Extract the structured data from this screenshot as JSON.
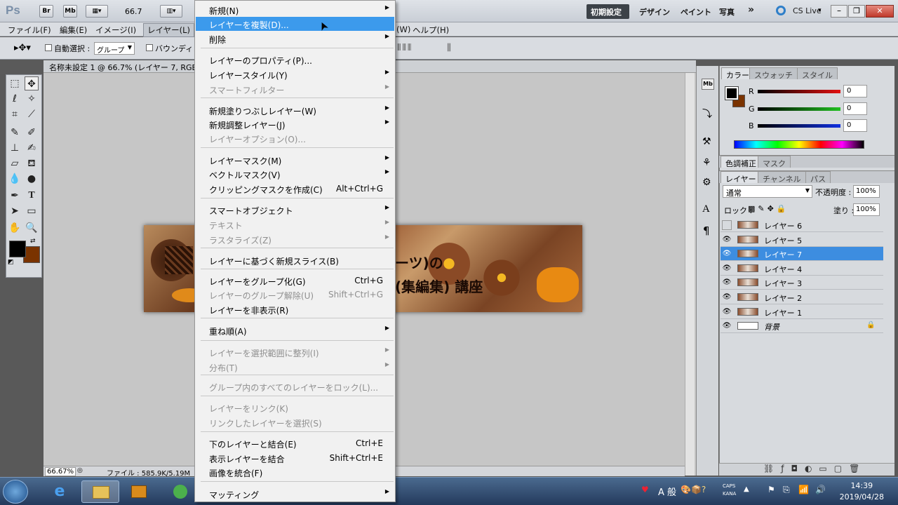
{
  "appbar": {
    "logo": "Ps",
    "br_label": "Br",
    "mb_label": "Mb",
    "zoom": "66.7",
    "workspaces": [
      "初期設定",
      "デザイン",
      "ペイント",
      "写真"
    ],
    "more": "»",
    "cs_live": "CS Live"
  },
  "menubar": [
    "ファイル(F)",
    "編集(E)",
    "イメージ(I)",
    "レイヤー(L)",
    "(W)",
    "ヘルプ(H)"
  ],
  "options": {
    "auto_select_label": "自動選択 :",
    "auto_select_value": "グループ",
    "bounding_label": "バウンディング"
  },
  "document": {
    "tab_title": "名称未設定 1 @ 66.7% (レイヤー 7, RGB/",
    "banner_text_1": "ーツ)の",
    "banner_text_2": "(集編集) 講座",
    "status_zoom": "66.67%",
    "status_file": "ファイル : 585.9K/5.19M"
  },
  "layer_menu": {
    "items": [
      {
        "label": "新規(N)",
        "shortcut": "",
        "arrow": true,
        "disabled": false
      },
      {
        "label": "レイヤーを複製(D)...",
        "shortcut": "",
        "arrow": false,
        "disabled": false,
        "highlighted": true
      },
      {
        "label": "削除",
        "shortcut": "",
        "arrow": true,
        "disabled": false
      },
      {
        "label": "レイヤーのプロパティ(P)...",
        "shortcut": "",
        "arrow": false,
        "disabled": false
      },
      {
        "label": "レイヤースタイル(Y)",
        "shortcut": "",
        "arrow": true,
        "disabled": false
      },
      {
        "label": "スマートフィルター",
        "shortcut": "",
        "arrow": true,
        "disabled": true
      },
      {
        "label": "新規塗りつぶしレイヤー(W)",
        "shortcut": "",
        "arrow": true,
        "disabled": false
      },
      {
        "label": "新規調整レイヤー(J)",
        "shortcut": "",
        "arrow": true,
        "disabled": false
      },
      {
        "label": "レイヤーオプション(O)...",
        "shortcut": "",
        "arrow": false,
        "disabled": true
      },
      {
        "label": "レイヤーマスク(M)",
        "shortcut": "",
        "arrow": true,
        "disabled": false
      },
      {
        "label": "ベクトルマスク(V)",
        "shortcut": "",
        "arrow": true,
        "disabled": false
      },
      {
        "label": "クリッピングマスクを作成(C)",
        "shortcut": "Alt+Ctrl+G",
        "arrow": false,
        "disabled": false
      },
      {
        "label": "スマートオブジェクト",
        "shortcut": "",
        "arrow": true,
        "disabled": false
      },
      {
        "label": "テキスト",
        "shortcut": "",
        "arrow": true,
        "disabled": true
      },
      {
        "label": "ラスタライズ(Z)",
        "shortcut": "",
        "arrow": true,
        "disabled": true
      },
      {
        "label": "レイヤーに基づく新規スライス(B)",
        "shortcut": "",
        "arrow": false,
        "disabled": false
      },
      {
        "label": "レイヤーをグループ化(G)",
        "shortcut": "Ctrl+G",
        "arrow": false,
        "disabled": false
      },
      {
        "label": "レイヤーのグループ解除(U)",
        "shortcut": "Shift+Ctrl+G",
        "arrow": false,
        "disabled": true
      },
      {
        "label": "レイヤーを非表示(R)",
        "shortcut": "",
        "arrow": false,
        "disabled": false
      },
      {
        "label": "重ね順(A)",
        "shortcut": "",
        "arrow": true,
        "disabled": false
      },
      {
        "label": "レイヤーを選択範囲に整列(I)",
        "shortcut": "",
        "arrow": true,
        "disabled": true
      },
      {
        "label": "分布(T)",
        "shortcut": "",
        "arrow": true,
        "disabled": true
      },
      {
        "label": "グループ内のすべてのレイヤーをロック(L)...",
        "shortcut": "",
        "arrow": false,
        "disabled": true
      },
      {
        "label": "レイヤーをリンク(K)",
        "shortcut": "",
        "arrow": false,
        "disabled": true
      },
      {
        "label": "リンクしたレイヤーを選択(S)",
        "shortcut": "",
        "arrow": false,
        "disabled": true
      },
      {
        "label": "下のレイヤーと結合(E)",
        "shortcut": "Ctrl+E",
        "arrow": false,
        "disabled": false
      },
      {
        "label": "表示レイヤーを結合",
        "shortcut": "Shift+Ctrl+E",
        "arrow": false,
        "disabled": false
      },
      {
        "label": "画像を統合(F)",
        "shortcut": "",
        "arrow": false,
        "disabled": false
      },
      {
        "label": "マッティング",
        "shortcut": "",
        "arrow": true,
        "disabled": false
      }
    ]
  },
  "color_panel": {
    "tabs": [
      "カラー",
      "スウォッチ",
      "スタイル"
    ],
    "r_label": "R",
    "g_label": "G",
    "b_label": "B",
    "r": "0",
    "g": "0",
    "b": "0",
    "fg": "#000000",
    "bg": "#7a3300"
  },
  "adjust_panel": {
    "tabs": [
      "色調補正",
      "マスク"
    ]
  },
  "layers_panel": {
    "tabs": [
      "レイヤー",
      "チャンネル",
      "パス"
    ],
    "blend_mode": "通常",
    "opacity_label": "不透明度 :",
    "opacity": "100%",
    "lock_label": "ロック :",
    "fill_label": "塗り :",
    "fill": "100%",
    "layers": [
      {
        "name": "レイヤー 6",
        "visible": false,
        "selected": false
      },
      {
        "name": "レイヤー 5",
        "visible": true,
        "selected": false
      },
      {
        "name": "レイヤー 7",
        "visible": true,
        "selected": true
      },
      {
        "name": "レイヤー 4",
        "visible": true,
        "selected": false
      },
      {
        "name": "レイヤー 3",
        "visible": true,
        "selected": false
      },
      {
        "name": "レイヤー 2",
        "visible": true,
        "selected": false
      },
      {
        "name": "レイヤー 1",
        "visible": true,
        "selected": false
      },
      {
        "name": "背景",
        "visible": true,
        "selected": false,
        "locked": true
      }
    ]
  },
  "taskbar": {
    "time": "14:39",
    "date": "2019/04/28",
    "ime": "A 般",
    "caps": "CAPS",
    "kana": "KANA"
  }
}
